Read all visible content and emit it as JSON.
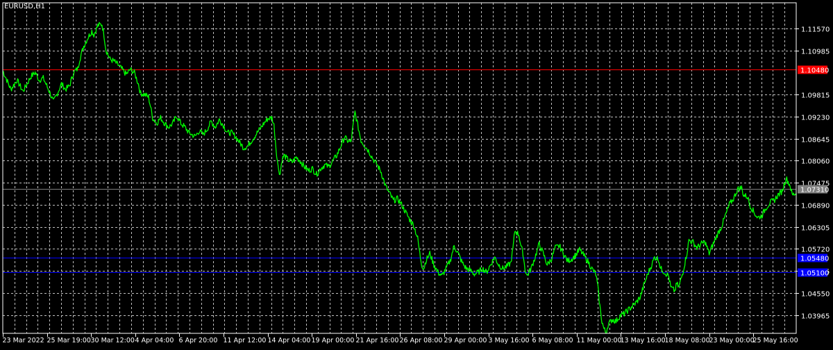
{
  "symbol_label": "EURUSD,H1",
  "colors": {
    "background": "#000000",
    "grid": "#c0c0c0",
    "axis": "#ffffff",
    "text": "#ffffff",
    "price_line": "#00ff00"
  },
  "chart_data": {
    "type": "line",
    "title": "",
    "xlabel": "",
    "ylabel": "",
    "grid": true,
    "ylim": [
      1.0348,
      1.1225
    ],
    "y_ticks": [
      "1.11570",
      "1.10985",
      "1.09815",
      "1.09230",
      "1.08645",
      "1.08060",
      "1.07475",
      "1.06890",
      "1.06305",
      "1.05720",
      "1.05135",
      "1.04550",
      "1.03965"
    ],
    "x_tick_labels": [
      "23 Mar 2022",
      "25 Mar 19:00",
      "30 Mar 12:00",
      "4 Apr 04:00",
      "6 Apr 20:00",
      "11 Apr 12:00",
      "14 Apr 04:00",
      "19 Apr 00:00",
      "21 Apr 16:00",
      "26 Apr 08:00",
      "29 Apr 00:00",
      "3 May 16:00",
      "6 May 08:00",
      "11 May 00:00",
      "13 May 16:00",
      "18 May 08:00",
      "23 May 00:00",
      "25 May 16:00"
    ],
    "horizontal_lines": [
      {
        "label": "1.10480",
        "value": 1.1048,
        "color": "#ff0000",
        "label_bg": "#ff0000"
      },
      {
        "label": "1.07310",
        "value": 1.0731,
        "color": "#808080",
        "label_bg": "#808080"
      },
      {
        "label": "1.05480",
        "value": 1.0548,
        "color": "#0000ff",
        "label_bg": "#0000ff"
      },
      {
        "label": "1.05100",
        "value": 1.051,
        "color": "#0000ff",
        "label_bg": "#0000ff"
      }
    ],
    "series": [
      {
        "color": "#00ff00",
        "points": [
          [
            0,
            1.1045
          ],
          [
            4,
            1.0995
          ],
          [
            7,
            1.102
          ],
          [
            10,
            1.099
          ],
          [
            14,
            1.103
          ],
          [
            16,
            1.104
          ],
          [
            18,
            1.102
          ],
          [
            20,
            1.1025
          ],
          [
            23,
            1.099
          ],
          [
            25,
            1.0962
          ],
          [
            27,
            1.0985
          ],
          [
            29,
            1.101
          ],
          [
            31,
            1.0995
          ],
          [
            33,
            1.1005
          ],
          [
            35,
            1.104
          ],
          [
            37,
            1.105
          ],
          [
            38,
            1.1075
          ],
          [
            40,
            1.111
          ],
          [
            42,
            1.1132
          ],
          [
            44,
            1.115
          ],
          [
            45,
            1.114
          ],
          [
            47,
            1.1165
          ],
          [
            49,
            1.1168
          ],
          [
            50,
            1.114
          ],
          [
            51,
            1.11
          ],
          [
            53,
            1.1075
          ],
          [
            55,
            1.107
          ],
          [
            57,
            1.106
          ],
          [
            59,
            1.1048
          ],
          [
            61,
            1.1035
          ],
          [
            63,
            1.1048
          ],
          [
            65,
            1.104
          ],
          [
            67,
            1.101
          ],
          [
            68,
            1.0985
          ],
          [
            70,
            1.0982
          ],
          [
            72,
            1.0975
          ],
          [
            73,
            1.095
          ],
          [
            74,
            1.092
          ],
          [
            76,
            1.0905
          ],
          [
            78,
            1.092
          ],
          [
            80,
            1.0905
          ],
          [
            82,
            1.0895
          ],
          [
            84,
            1.0905
          ],
          [
            86,
            1.0925
          ],
          [
            88,
            1.0905
          ],
          [
            90,
            1.0895
          ],
          [
            92,
            1.088
          ],
          [
            95,
            1.087
          ],
          [
            97,
            1.0885
          ],
          [
            99,
            1.0875
          ],
          [
            101,
            1.089
          ],
          [
            103,
            1.091
          ],
          [
            105,
            1.0895
          ],
          [
            107,
            1.0915
          ],
          [
            109,
            1.09
          ],
          [
            111,
            1.088
          ],
          [
            113,
            1.088
          ],
          [
            115,
            1.087
          ],
          [
            117,
            1.0855
          ],
          [
            119,
            1.084
          ],
          [
            121,
            1.0845
          ],
          [
            123,
            1.086
          ],
          [
            125,
            1.0875
          ],
          [
            127,
            1.089
          ],
          [
            129,
            1.0905
          ],
          [
            131,
            1.0918
          ],
          [
            133,
            1.092
          ],
          [
            134,
            1.09
          ],
          [
            135,
            1.084
          ],
          [
            136,
            1.079
          ],
          [
            137,
            1.077
          ],
          [
            138,
            1.081
          ],
          [
            139,
            1.082
          ],
          [
            141,
            1.0808
          ],
          [
            143,
            1.0802
          ],
          [
            145,
            1.0815
          ],
          [
            147,
            1.0805
          ],
          [
            149,
            1.079
          ],
          [
            151,
            1.078
          ],
          [
            153,
            1.0785
          ],
          [
            155,
            1.077
          ],
          [
            157,
            1.0785
          ],
          [
            159,
            1.0795
          ],
          [
            161,
            1.079
          ],
          [
            163,
            1.0805
          ],
          [
            165,
            1.082
          ],
          [
            167,
            1.0845
          ],
          [
            169,
            1.087
          ],
          [
            170,
            1.086
          ],
          [
            172,
            1.0855
          ],
          [
            173,
            1.0895
          ],
          [
            174,
            1.0935
          ],
          [
            175,
            1.091
          ],
          [
            177,
            1.086
          ],
          [
            179,
            1.0845
          ],
          [
            181,
            1.083
          ],
          [
            183,
            1.081
          ],
          [
            185,
            1.0795
          ],
          [
            187,
            1.0775
          ],
          [
            189,
            1.074
          ],
          [
            191,
            1.072
          ],
          [
            193,
            1.07
          ],
          [
            195,
            1.0705
          ],
          [
            197,
            1.069
          ],
          [
            199,
            1.067
          ],
          [
            201,
            1.065
          ],
          [
            203,
            1.0635
          ],
          [
            205,
            1.06
          ],
          [
            206,
            1.056
          ],
          [
            207,
            1.053
          ],
          [
            208,
            1.052
          ],
          [
            209,
            1.054
          ],
          [
            211,
            1.056
          ],
          [
            213,
            1.053
          ],
          [
            215,
            1.051
          ],
          [
            217,
            1.05
          ],
          [
            219,
            1.052
          ],
          [
            221,
            1.054
          ],
          [
            223,
            1.058
          ],
          [
            225,
            1.056
          ],
          [
            227,
            1.0535
          ],
          [
            229,
            1.052
          ],
          [
            231,
            1.0515
          ],
          [
            233,
            1.0505
          ],
          [
            235,
            1.051
          ],
          [
            237,
            1.052
          ],
          [
            239,
            1.051
          ],
          [
            241,
            1.053
          ],
          [
            243,
            1.055
          ],
          [
            245,
            1.053
          ],
          [
            247,
            1.052
          ],
          [
            249,
            1.0525
          ],
          [
            251,
            1.0535
          ],
          [
            252,
            1.057
          ],
          [
            253,
            1.062
          ],
          [
            255,
            1.061
          ],
          [
            256,
            1.058
          ],
          [
            257,
            1.056
          ],
          [
            258,
            1.052
          ],
          [
            259,
            1.05
          ],
          [
            261,
            1.052
          ],
          [
            263,
            1.055
          ],
          [
            265,
            1.0585
          ],
          [
            267,
            1.056
          ],
          [
            269,
            1.053
          ],
          [
            271,
            1.0545
          ],
          [
            273,
            1.0575
          ],
          [
            275,
            1.058
          ],
          [
            277,
            1.056
          ],
          [
            279,
            1.054
          ],
          [
            281,
            1.0545
          ],
          [
            283,
            1.0555
          ],
          [
            285,
            1.057
          ],
          [
            287,
            1.0555
          ],
          [
            289,
            1.054
          ],
          [
            291,
            1.052
          ],
          [
            293,
            1.0505
          ],
          [
            294,
            1.047
          ],
          [
            295,
            1.042
          ],
          [
            296,
            1.038
          ],
          [
            297,
            1.036
          ],
          [
            298,
            1.035
          ],
          [
            299,
            1.037
          ],
          [
            301,
            1.0385
          ],
          [
            303,
            1.038
          ],
          [
            305,
            1.0395
          ],
          [
            307,
            1.04
          ],
          [
            309,
            1.041
          ],
          [
            311,
            1.042
          ],
          [
            313,
            1.043
          ],
          [
            315,
            1.0445
          ],
          [
            317,
            1.048
          ],
          [
            319,
            1.051
          ],
          [
            321,
            1.0535
          ],
          [
            322,
            1.055
          ],
          [
            324,
            1.0545
          ],
          [
            325,
            1.052
          ],
          [
            327,
            1.051
          ],
          [
            329,
            1.05
          ],
          [
            330,
            1.047
          ],
          [
            332,
            1.046
          ],
          [
            333,
            1.048
          ],
          [
            334,
            1.047
          ],
          [
            336,
            1.051
          ],
          [
            338,
            1.056
          ],
          [
            339,
            1.0595
          ],
          [
            341,
            1.059
          ],
          [
            343,
            1.0575
          ],
          [
            345,
            1.0585
          ],
          [
            347,
            1.059
          ],
          [
            349,
            1.056
          ],
          [
            351,
            1.0585
          ],
          [
            353,
            1.061
          ],
          [
            355,
            1.063
          ],
          [
            357,
            1.066
          ],
          [
            359,
            1.069
          ],
          [
            361,
            1.0705
          ],
          [
            363,
            1.073
          ],
          [
            365,
            1.0735
          ],
          [
            366,
            1.0715
          ],
          [
            368,
            1.071
          ],
          [
            369,
            1.069
          ],
          [
            371,
            1.067
          ],
          [
            373,
            1.0655
          ],
          [
            375,
            1.066
          ],
          [
            377,
            1.068
          ],
          [
            379,
            1.0695
          ],
          [
            381,
            1.07
          ],
          [
            383,
            1.0715
          ],
          [
            385,
            1.0725
          ],
          [
            387,
            1.076
          ],
          [
            389,
            1.074
          ],
          [
            390,
            1.0715
          ],
          [
            392,
            1.072
          ]
        ]
      }
    ],
    "x_range": [
      0,
      392
    ]
  }
}
